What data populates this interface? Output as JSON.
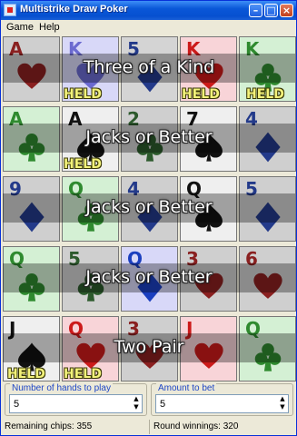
{
  "window": {
    "title": "Multistrike Draw Poker"
  },
  "menu": {
    "game": "Game",
    "help": "Help"
  },
  "colors": {
    "red": "#cc1a1a",
    "black": "#111111",
    "green_suit": "#2f8a2f",
    "blue_suit": "#1b3fbf",
    "held": "#f3f27a"
  },
  "hands": [
    {
      "result": "Three of a Kind",
      "cards": [
        {
          "rank": "A",
          "suit": "heart",
          "bg": "#cfcfcf",
          "rank_color": "#8a2020",
          "suit_color": "#8a2020",
          "held": false
        },
        {
          "rank": "K",
          "suit": "heart",
          "bg": "#d8d8f8",
          "rank_color": "#6b6ad0",
          "suit_color": "#6b6ad0",
          "held": true
        },
        {
          "rank": "5",
          "suit": "diamond",
          "bg": "#d4d4d4",
          "rank_color": "#233a8a",
          "suit_color": "#233a8a",
          "held": false
        },
        {
          "rank": "K",
          "suit": "heart",
          "bg": "#f8d4d8",
          "rank_color": "#cc1a1a",
          "suit_color": "#cc1a1a",
          "held": true
        },
        {
          "rank": "K",
          "suit": "club",
          "bg": "#d4f0d4",
          "rank_color": "#2f8a2f",
          "suit_color": "#2f8a2f",
          "held": true
        }
      ]
    },
    {
      "result": "Jacks or Better",
      "cards": [
        {
          "rank": "A",
          "suit": "club",
          "bg": "#d4f0d4",
          "rank_color": "#2f8a2f",
          "suit_color": "#2f8a2f",
          "held": false
        },
        {
          "rank": "A",
          "suit": "spade",
          "bg": "#efefef",
          "rank_color": "#111111",
          "suit_color": "#111111",
          "held": true
        },
        {
          "rank": "2",
          "suit": "club",
          "bg": "#cfcfcf",
          "rank_color": "#2c5a2c",
          "suit_color": "#2c5a2c",
          "held": false
        },
        {
          "rank": "7",
          "suit": "spade",
          "bg": "#efefef",
          "rank_color": "#111111",
          "suit_color": "#111111",
          "held": false
        },
        {
          "rank": "4",
          "suit": "diamond",
          "bg": "#cfcfcf",
          "rank_color": "#233a8a",
          "suit_color": "#233a8a",
          "held": false
        }
      ]
    },
    {
      "result": "Jacks or Better",
      "cards": [
        {
          "rank": "9",
          "suit": "diamond",
          "bg": "#cfcfcf",
          "rank_color": "#233a8a",
          "suit_color": "#233a8a",
          "held": false
        },
        {
          "rank": "Q",
          "suit": "club",
          "bg": "#d4f0d4",
          "rank_color": "#2f8a2f",
          "suit_color": "#2f8a2f",
          "held": false
        },
        {
          "rank": "4",
          "suit": "diamond",
          "bg": "#cfcfcf",
          "rank_color": "#233a8a",
          "suit_color": "#233a8a",
          "held": false
        },
        {
          "rank": "Q",
          "suit": "spade",
          "bg": "#efefef",
          "rank_color": "#111111",
          "suit_color": "#111111",
          "held": false
        },
        {
          "rank": "5",
          "suit": "diamond",
          "bg": "#cfcfcf",
          "rank_color": "#233a8a",
          "suit_color": "#233a8a",
          "held": false
        }
      ]
    },
    {
      "result": "Jacks or Better",
      "cards": [
        {
          "rank": "Q",
          "suit": "club",
          "bg": "#d4f0d4",
          "rank_color": "#2f8a2f",
          "suit_color": "#2f8a2f",
          "held": false
        },
        {
          "rank": "5",
          "suit": "club",
          "bg": "#cfcfcf",
          "rank_color": "#2c5a2c",
          "suit_color": "#2c5a2c",
          "held": false
        },
        {
          "rank": "Q",
          "suit": "diamond",
          "bg": "#d8d8f8",
          "rank_color": "#1b3fbf",
          "suit_color": "#1b3fbf",
          "held": false
        },
        {
          "rank": "3",
          "suit": "heart",
          "bg": "#cfcfcf",
          "rank_color": "#8a2020",
          "suit_color": "#8a2020",
          "held": false
        },
        {
          "rank": "6",
          "suit": "heart",
          "bg": "#cfcfcf",
          "rank_color": "#8a2020",
          "suit_color": "#8a2020",
          "held": false
        }
      ]
    },
    {
      "result": "Two Pair",
      "cards": [
        {
          "rank": "J",
          "suit": "spade",
          "bg": "#efefef",
          "rank_color": "#111111",
          "suit_color": "#111111",
          "held": true
        },
        {
          "rank": "Q",
          "suit": "heart",
          "bg": "#f8d4d8",
          "rank_color": "#cc1a1a",
          "suit_color": "#cc1a1a",
          "held": true
        },
        {
          "rank": "3",
          "suit": "heart",
          "bg": "#cfcfcf",
          "rank_color": "#8a2020",
          "suit_color": "#8a2020",
          "held": false
        },
        {
          "rank": "J",
          "suit": "heart",
          "bg": "#f8d4d8",
          "rank_color": "#cc1a1a",
          "suit_color": "#cc1a1a",
          "held": false
        },
        {
          "rank": "Q",
          "suit": "club",
          "bg": "#d4f0d4",
          "rank_color": "#2f8a2f",
          "suit_color": "#2f8a2f",
          "held": false
        }
      ]
    }
  ],
  "held_label": "HELD",
  "controls": {
    "hands": {
      "label": "Number of hands to play",
      "value": "5"
    },
    "bet": {
      "label": "Amount to bet",
      "value": "5"
    }
  },
  "status": {
    "chips": "Remaining chips: 355",
    "winnings": "Round winnings: 320"
  }
}
